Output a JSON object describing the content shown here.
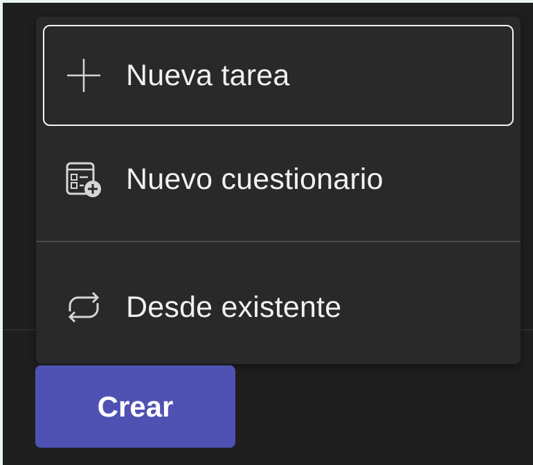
{
  "menu": {
    "items": [
      {
        "label": "Nueva tarea",
        "icon": "add-icon",
        "focused": true
      },
      {
        "label": "Nuevo cuestionario",
        "icon": "quiz-add-icon",
        "focused": false
      },
      {
        "label": "Desde existente",
        "icon": "reuse-arrows-icon",
        "focused": false
      }
    ]
  },
  "footer": {
    "create_label": "Crear"
  },
  "colors": {
    "background": "#1f1f1f",
    "menu": "#292929",
    "accent": "#4f52b2",
    "text": "#f1f1f1",
    "frame": "#e8f6ee"
  }
}
